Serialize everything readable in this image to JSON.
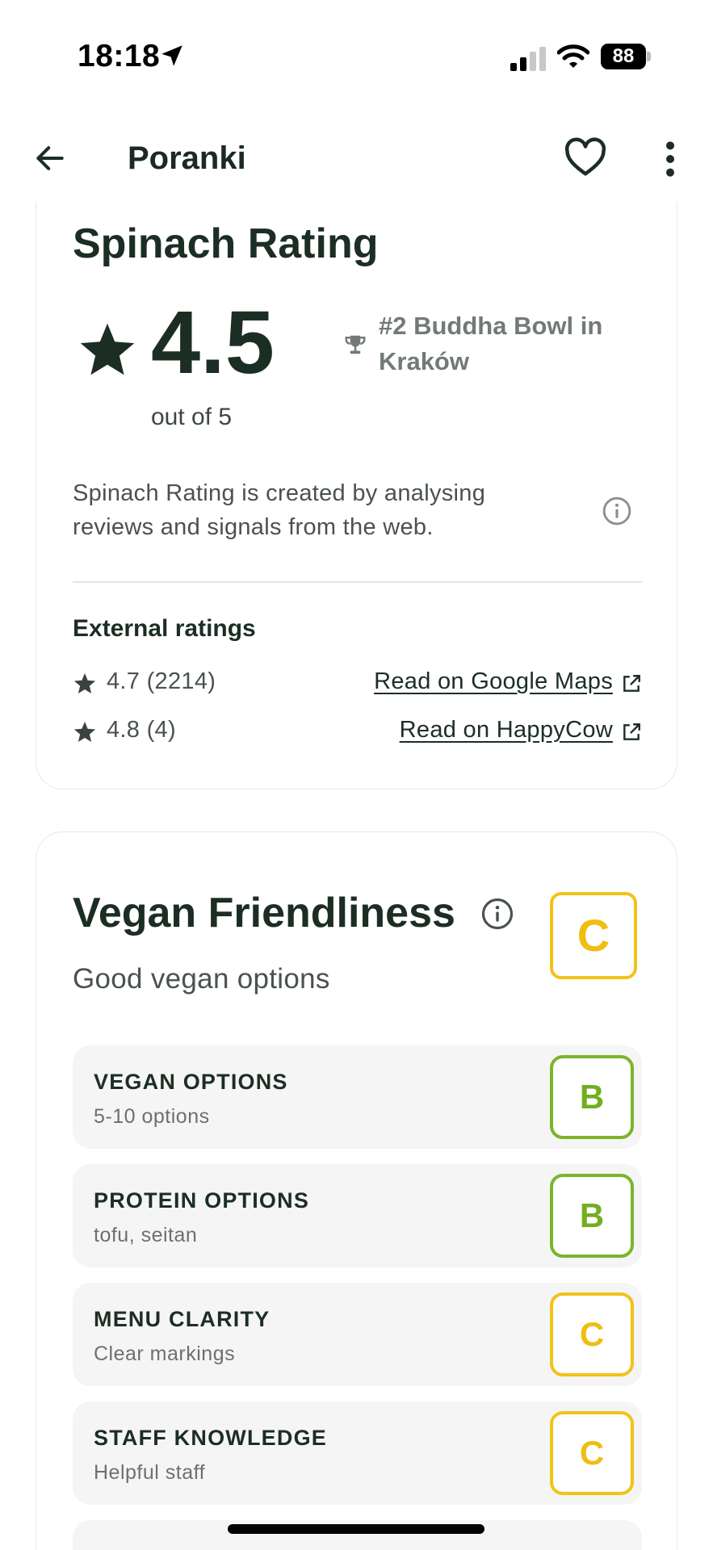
{
  "status_bar": {
    "time": "18:18",
    "battery": "88",
    "icons": [
      "location-arrow-icon",
      "signal-bars-icon",
      "wifi-icon",
      "battery-icon"
    ]
  },
  "top_bar": {
    "title": "Poranki",
    "icons": [
      "back-arrow-icon",
      "heart-icon",
      "more-vertical-icon"
    ]
  },
  "rating": {
    "title": "Spinach Rating",
    "score": "4.5",
    "out_of": "out of 5",
    "rank": "#2 Buddha Bowl in Kraków",
    "description": "Spinach Rating is created by analysing reviews and signals from the web.",
    "external_heading": "External ratings",
    "external": [
      {
        "value": "4.7 (2214)",
        "link": "Read on Google Maps"
      },
      {
        "value": "4.8 (4)",
        "link": "Read on HappyCow"
      }
    ]
  },
  "vegan": {
    "title": "Vegan Friendliness",
    "grade": "C",
    "subtitle": "Good vegan options",
    "metrics": [
      {
        "name": "VEGAN OPTIONS",
        "detail": "5-10 options",
        "grade": "B"
      },
      {
        "name": "PROTEIN OPTIONS",
        "detail": "tofu, seitan",
        "grade": "B"
      },
      {
        "name": "MENU CLARITY",
        "detail": "Clear markings",
        "grade": "C"
      },
      {
        "name": "STAFF KNOWLEDGE",
        "detail": "Helpful staff",
        "grade": "C"
      }
    ]
  },
  "colors": {
    "text_dark": "#1c2e24",
    "grade_b": "#7ab52b",
    "grade_c": "#f3c21a",
    "row_bg": "#f5f5f5"
  }
}
